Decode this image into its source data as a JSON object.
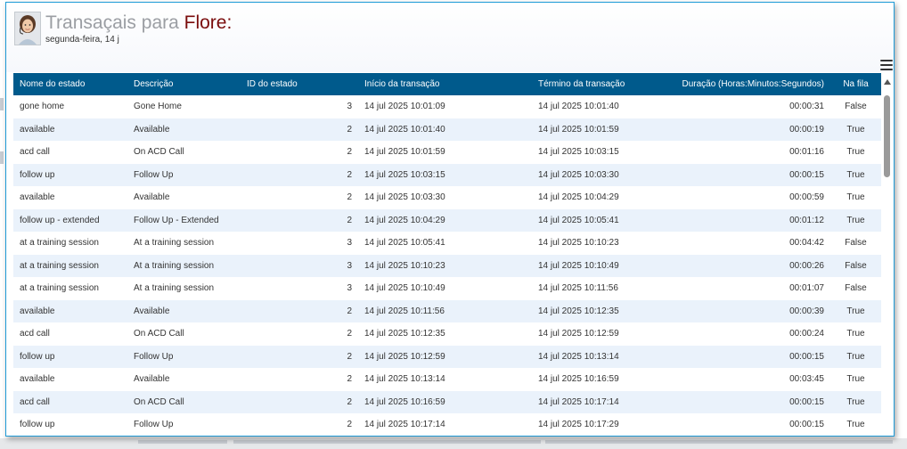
{
  "window": {
    "title_prefix": "Transaçais para ",
    "title_agent": "Flore:",
    "subtitle": "segunda-feira, 14 j"
  },
  "icons": {
    "menu": "hamburger-menu-icon",
    "avatar": "agent-avatar",
    "scroll_up": "scroll-up-arrow-icon"
  },
  "colors": {
    "header_bg": "#005a8c",
    "row_alt": "#eaf2fb",
    "border": "#1f9bd7",
    "agent_name": "#7a0c0c"
  },
  "table": {
    "columns": [
      "Nome do estado",
      "Descrição",
      "ID do estado",
      "Início da transação",
      "Término da transação",
      "Duração (Horas:Minutos:Segundos)",
      "Na fila"
    ],
    "rows": [
      [
        "gone home",
        "Gone Home",
        "3",
        "14 jul 2025 10:01:09",
        "14 jul 2025 10:01:40",
        "00:00:31",
        "False"
      ],
      [
        "available",
        "Available",
        "2",
        "14 jul 2025 10:01:40",
        "14 jul 2025 10:01:59",
        "00:00:19",
        "True"
      ],
      [
        "acd call",
        "On ACD Call",
        "2",
        "14 jul 2025 10:01:59",
        "14 jul 2025 10:03:15",
        "00:01:16",
        "True"
      ],
      [
        "follow up",
        "Follow Up",
        "2",
        "14 jul 2025 10:03:15",
        "14 jul 2025 10:03:30",
        "00:00:15",
        "True"
      ],
      [
        "available",
        "Available",
        "2",
        "14 jul 2025 10:03:30",
        "14 jul 2025 10:04:29",
        "00:00:59",
        "True"
      ],
      [
        "follow up - extended",
        "Follow Up - Extended",
        "2",
        "14 jul 2025 10:04:29",
        "14 jul 2025 10:05:41",
        "00:01:12",
        "True"
      ],
      [
        "at a training session",
        "At a training session",
        "3",
        "14 jul 2025 10:05:41",
        "14 jul 2025 10:10:23",
        "00:04:42",
        "False"
      ],
      [
        "at a training session",
        "At a training session",
        "3",
        "14 jul 2025 10:10:23",
        "14 jul 2025 10:10:49",
        "00:00:26",
        "False"
      ],
      [
        "at a training session",
        "At a training session",
        "3",
        "14 jul 2025 10:10:49",
        "14 jul 2025 10:11:56",
        "00:01:07",
        "False"
      ],
      [
        "available",
        "Available",
        "2",
        "14 jul 2025 10:11:56",
        "14 jul 2025 10:12:35",
        "00:00:39",
        "True"
      ],
      [
        "acd call",
        "On ACD Call",
        "2",
        "14 jul 2025 10:12:35",
        "14 jul 2025 10:12:59",
        "00:00:24",
        "True"
      ],
      [
        "follow up",
        "Follow Up",
        "2",
        "14 jul 2025 10:12:59",
        "14 jul 2025 10:13:14",
        "00:00:15",
        "True"
      ],
      [
        "available",
        "Available",
        "2",
        "14 jul 2025 10:13:14",
        "14 jul 2025 10:16:59",
        "00:03:45",
        "True"
      ],
      [
        "acd call",
        "On ACD Call",
        "2",
        "14 jul 2025 10:16:59",
        "14 jul 2025 10:17:14",
        "00:00:15",
        "True"
      ],
      [
        "follow up",
        "Follow Up",
        "2",
        "14 jul 2025 10:17:14",
        "14 jul 2025 10:17:29",
        "00:00:15",
        "True"
      ]
    ]
  }
}
